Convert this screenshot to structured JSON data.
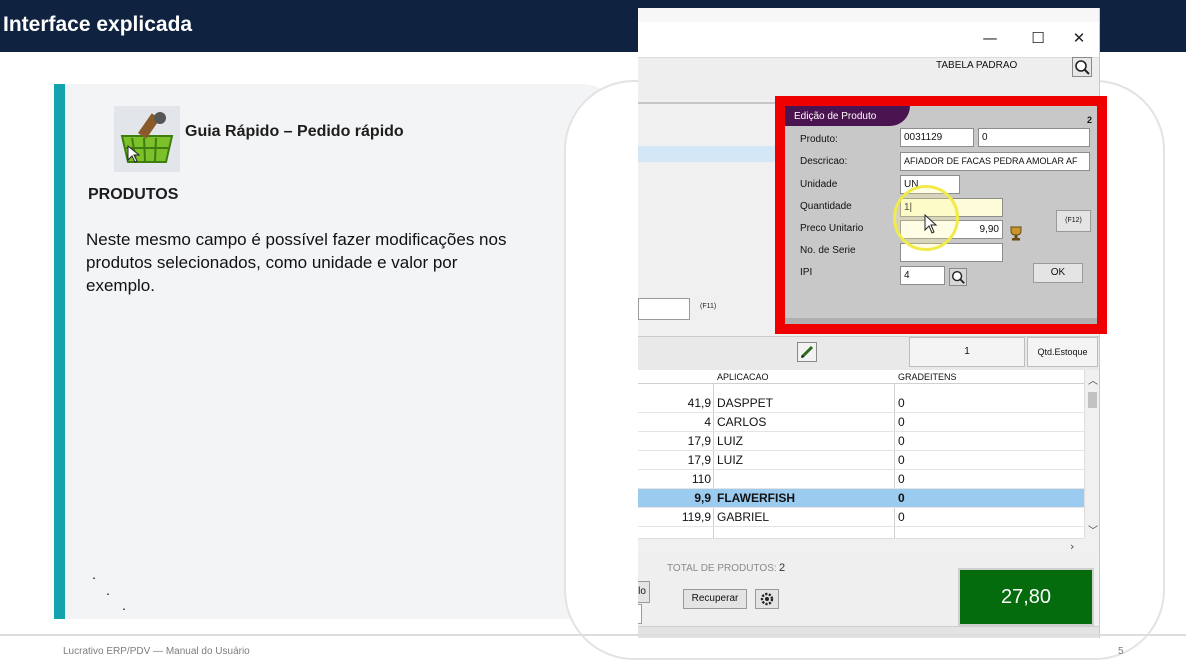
{
  "slide": {
    "title": "Interface explicada",
    "guide_title": "Guia Rápido – Pedido rápido",
    "section_heading": "PRODUTOS",
    "section_body": "Neste mesmo campo é possível fazer modificações nos produtos selecionados, como unidade e valor por exemplo.",
    "dots": [
      ".",
      ".",
      "."
    ],
    "footer_text": "Lucrativo ERP/PDV — Manual do Usuário",
    "page_number": "5",
    "colors": {
      "banner": "#0f2340",
      "accent": "#12a3ac",
      "highlight": "#ee0000"
    }
  },
  "window": {
    "controls": {
      "minimize": "—",
      "maximize": "☐",
      "close": "✕"
    },
    "tabela_label": "TABELA PADRAO",
    "f11_label": "(F11)"
  },
  "dialog": {
    "title": "Edição de Produto",
    "number": "2",
    "labels": {
      "produto": "Produto:",
      "descricao": "Descricao:",
      "unidade": "Unidade",
      "quantidade": "Quantidade",
      "preco": "Preco Unitario",
      "serie": "No. de Serie",
      "ipi": "IPI"
    },
    "values": {
      "produto_code": "0031129",
      "produto_sub": "0",
      "descricao": "AFIADOR DE FACAS PEDRA AMOLAR AF",
      "unidade": "UN",
      "quantidade": "1|",
      "preco": "9,90",
      "serie": "",
      "ipi": "4"
    },
    "f12_label": "(F12)",
    "ok_label": "OK"
  },
  "table": {
    "count_value": "1",
    "qtd_estoque_label": "Qtd.Estoque",
    "headers": [
      "",
      "APLICACAO",
      "GRADEITENS"
    ],
    "rows": [
      {
        "value": "41,9",
        "aplicacao": "DASPPET",
        "grade": "0",
        "selected": false
      },
      {
        "value": "4",
        "aplicacao": "CARLOS",
        "grade": "0",
        "selected": false
      },
      {
        "value": "17,9",
        "aplicacao": "LUIZ",
        "grade": "0",
        "selected": false
      },
      {
        "value": "17,9",
        "aplicacao": "LUIZ",
        "grade": "0",
        "selected": false
      },
      {
        "value": "110",
        "aplicacao": "",
        "grade": "0",
        "selected": false
      },
      {
        "value": "9,9",
        "aplicacao": "FLAWERFISH",
        "grade": "0",
        "selected": true
      },
      {
        "value": "119,9",
        "aplicacao": "GABRIEL",
        "grade": "0",
        "selected": false
      }
    ]
  },
  "bottom": {
    "total_label": "TOTAL DE PRODUTOS:",
    "total_value": "2",
    "left_btn_label": "lo",
    "recuperar_label": "Recuperar",
    "total_amount": "27,80"
  }
}
